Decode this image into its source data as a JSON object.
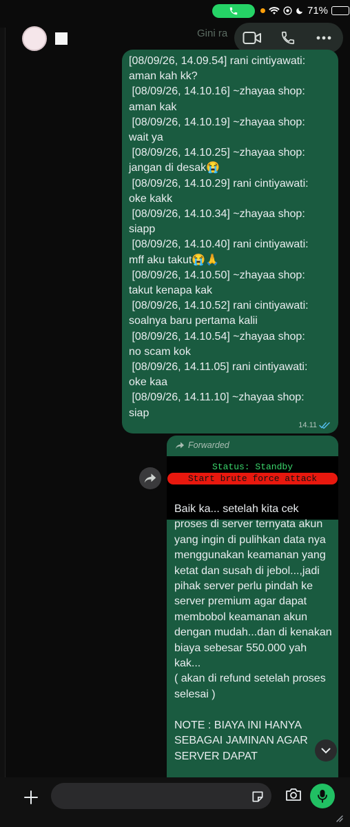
{
  "status_bar": {
    "battery": "71%",
    "battery_level": 0.71
  },
  "header": {
    "ghost_text": "Gini ra"
  },
  "chat_log": {
    "lines": "[08/09/26, 14.09.54] rani cintiyawati:\naman kah kk?\n [08/09/26, 14.10.16] ~zhayaa shop:\naman kak\n [08/09/26, 14.10.19] ~zhayaa shop:\nwait ya\n [08/09/26, 14.10.25] ~zhayaa shop:\njangan di desak😭\n [08/09/26, 14.10.29] rani cintiyawati:\noke kakk\n [08/09/26, 14.10.34] ~zhayaa shop:\nsiapp\n [08/09/26, 14.10.40] rani cintiyawati:\nmff aku takut😭🙏\n [08/09/26, 14.10.50] ~zhayaa shop:\ntakut kenapa kak\n [08/09/26, 14.10.52] rani cintiyawati:\nsoalnya baru pertama kalii\n [08/09/26, 14.10.54] ~zhayaa shop:\nno scam kok\n [08/09/26, 14.11.05] rani cintiyawati:\noke kaa\n [08/09/26, 14.11.10] ~zhayaa shop:\nsiap",
    "time": "14.11",
    "read_receipt_color": "#53bdeb"
  },
  "forwarded_message": {
    "label": "Forwarded",
    "terminal_status": "Status: Standby",
    "terminal_button": "Start brute force attack",
    "text": "Baik ka... setelah kita cek proses di server ternyata akun yang ingin di pulihkan data nya menggunakan keamanan yang ketat dan susah di jebol...,jadi pihak server perlu pindah ke server premium agar dapat membobol keamanan akun dengan mudah...dan di kenakan biaya sebesar 550.000 yah kak...\n( akan di refund setelah proses selesai )\n\nNOTE : BIAYA INI HANYA SEBAGAI JAMINAN AGAR SERVER DAPAT"
  },
  "input": {
    "value": "",
    "placeholder": ""
  },
  "colors": {
    "accent": "#25d366",
    "bubble": "#1a5b40",
    "terminal_green": "#3ad66b",
    "terminal_red": "#e8180e"
  }
}
